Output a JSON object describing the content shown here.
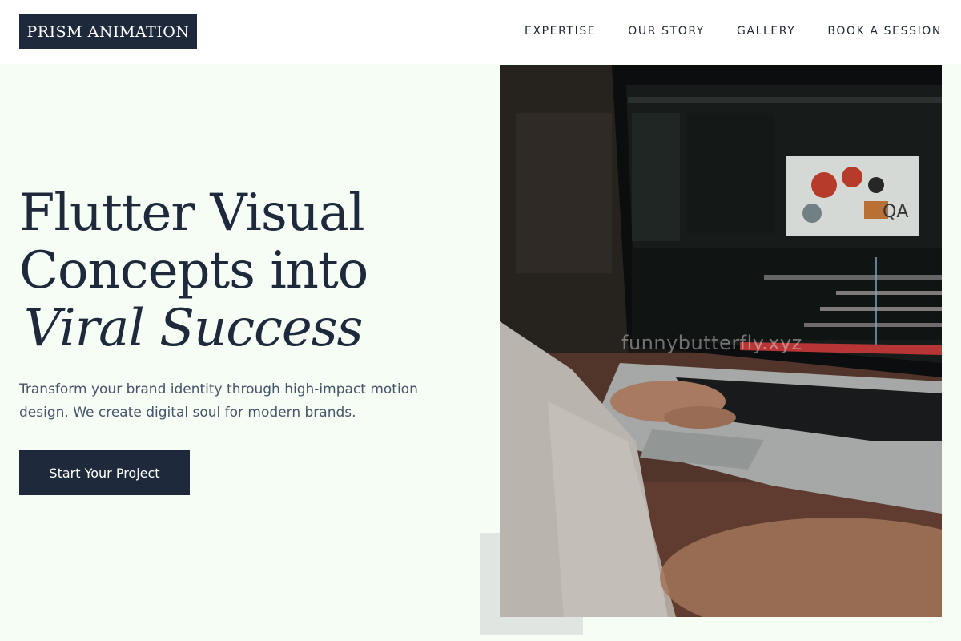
{
  "header": {
    "logo": "PRISM ANIMATION",
    "nav": [
      {
        "label": "EXPERTISE"
      },
      {
        "label": "OUR STORY"
      },
      {
        "label": "GALLERY"
      },
      {
        "label": "BOOK A SESSION"
      }
    ]
  },
  "hero": {
    "title_line1": "Flutter Visual",
    "title_line2": "Concepts into",
    "title_line3": "Viral Success",
    "subtitle": "Transform your brand identity through high-impact motion design. We create digital soul for modern brands.",
    "cta_label": "Start Your Project"
  },
  "image": {
    "watermark": "funnybutterfly.xyz",
    "screen_label": "QA"
  },
  "colors": {
    "background": "#f5fdf5",
    "primary": "#1e293b",
    "body_text": "#475569",
    "deco": "#e1e5e1"
  }
}
